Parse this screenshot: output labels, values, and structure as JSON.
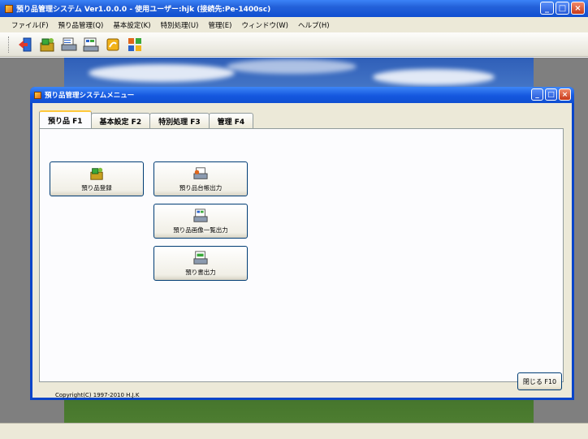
{
  "app": {
    "title": "預り品管理システム Ver1.0.0.0 - 使用ユーザー:hjk (接続先:Pe-1400sc)"
  },
  "menu": [
    "ファイル(F)",
    "預り品管理(Q)",
    "基本設定(K)",
    "特別処理(U)",
    "管理(E)",
    "ウィンドウ(W)",
    "ヘルプ(H)"
  ],
  "toolbar": {
    "icons": [
      "exit-icon",
      "deposit-register-icon",
      "ledger-print-icon",
      "image-list-icon",
      "receipt-print-icon",
      "settings-icon"
    ]
  },
  "menu_window": {
    "title": "預り品管理システムメニュー",
    "tabs": [
      {
        "label": "預り品 F1",
        "active": true
      },
      {
        "label": "基本設定 F2",
        "active": false
      },
      {
        "label": "特別処理 F3",
        "active": false
      },
      {
        "label": "管理 F4",
        "active": false
      }
    ],
    "buttons": {
      "register": "預り品登録",
      "ledger": "預り品台帳出力",
      "image_list": "預り品画像一覧出力",
      "receipt": "預り書出力"
    },
    "copyright": "Copyright(C) 1997-2010 H.J.K",
    "close": "閉じる F10"
  }
}
